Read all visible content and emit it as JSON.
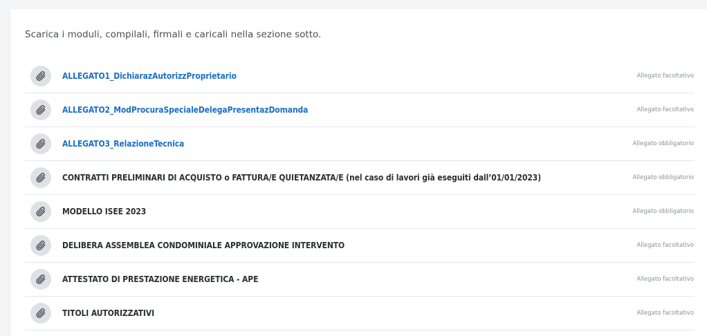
{
  "intro_text": "Scarica i moduli, compilali, firmali e caricali nella sezione sotto.",
  "attachments": [
    {
      "title": "ALLEGATO1_DichiarazAutorizzProprietario",
      "status": "Allegato facoltativo",
      "is_link": true
    },
    {
      "title": "ALLEGATO2_ModProcuraSpecialeDelegaPresentazDomanda",
      "status": "Allegato facoltativo",
      "is_link": true
    },
    {
      "title": "ALLEGATO3_RelazioneTecnica",
      "status": "Allegato obbligatorio",
      "is_link": true
    },
    {
      "title": "CONTRATTI PRELIMINARI DI ACQUISTO o FATTURA/E QUIETANZATA/E (nel caso di lavori già eseguiti dall’01/01/2023)",
      "status": "Allegato obbligatorio",
      "is_link": false
    },
    {
      "title": "MODELLO ISEE 2023",
      "status": "Allegato obbligatorio",
      "is_link": false
    },
    {
      "title": "DELIBERA ASSEMBLEA CONDOMINIALE APPROVAZIONE INTERVENTO",
      "status": "Allegato facoltativo",
      "is_link": false
    },
    {
      "title": "ATTESTATO DI PRESTAZIONE ENERGETICA - APE",
      "status": "Allegato facoltativo",
      "is_link": false
    },
    {
      "title": "TITOLI AUTORIZZATIVI",
      "status": "Allegato facoltativo",
      "is_link": false
    }
  ],
  "icons": {
    "row_icon": "paperclip-icon"
  },
  "colors": {
    "link": "#1b6fc9",
    "text": "#2b2f33",
    "icon_bg": "#dfe1e4"
  }
}
